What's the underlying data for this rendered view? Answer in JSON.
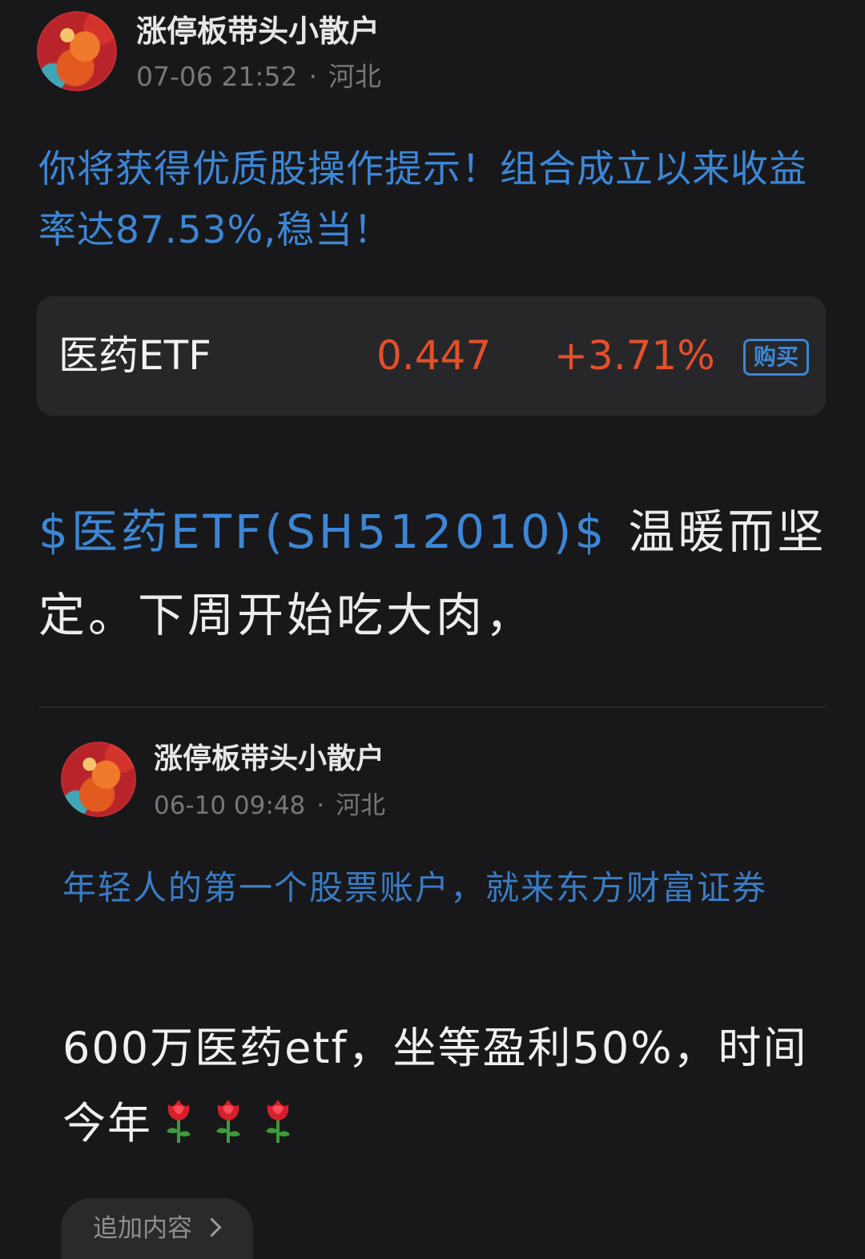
{
  "post": {
    "author": "涨停板带头小散户",
    "date": "07-06 21:52",
    "separator": "·",
    "location": "河北",
    "promo": "你将获得优质股操作提示！组合成立以来收益率达87.53%,稳当！",
    "stock_card": {
      "name": "医药ETF",
      "price": "0.447",
      "change": "+3.71%",
      "buy_label": "购买"
    },
    "stock_link": "$医药ETF(SH512010)$",
    "body_text": "温暖而坚定。下周开始吃大肉，"
  },
  "quoted_post": {
    "author": "涨停板带头小散户",
    "date": "06-10 09:48",
    "separator": "·",
    "location": "河北",
    "promo": "年轻人的第一个股票账户，就来东方财富证券",
    "body_text": "600万医药etf，坐等盈利50%，时间今年"
  },
  "append_button": {
    "label": "追加内容"
  },
  "colors": {
    "background": "#18181a",
    "link_blue": "#3d86d6",
    "stock_up_red": "#e4502a",
    "meta_gray": "#77777a",
    "card_bg": "#27272a"
  },
  "icons": {
    "avatar": "dragon-avatar",
    "rose": "rose-icon",
    "chevron": "chevron-right-icon"
  }
}
